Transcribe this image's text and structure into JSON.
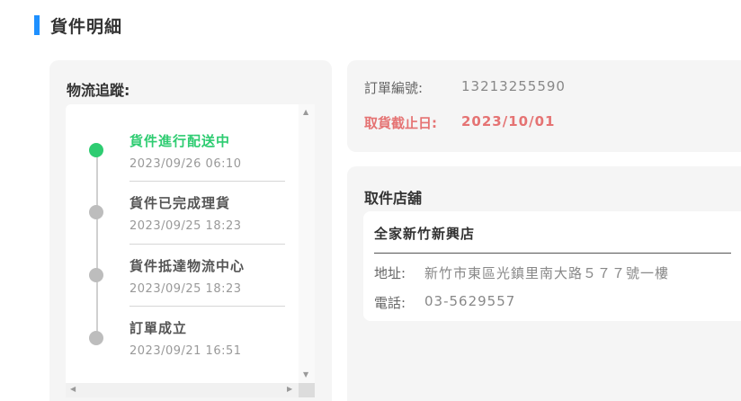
{
  "header": {
    "title": "貨件明細"
  },
  "tracking": {
    "label": "物流追蹤:",
    "steps": [
      {
        "title": "貨件進行配送中",
        "time": "2023/09/26 06:10",
        "active": true
      },
      {
        "title": "貨件已完成理貨",
        "time": "2023/09/25 18:23",
        "active": false
      },
      {
        "title": "貨件抵達物流中心",
        "time": "2023/09/25 18:23",
        "active": false
      },
      {
        "title": "訂單成立",
        "time": "2023/09/21 16:51",
        "active": false
      }
    ]
  },
  "order": {
    "number_label": "訂單編號:",
    "number_value": "13213255590",
    "deadline_label": "取貨截止日:",
    "deadline_value": "2023/10/01"
  },
  "store": {
    "title": "取件店舖",
    "name": "全家新竹新興店",
    "address_label": "地址:",
    "address_value": "新竹市東區光鎮里南大路５７７號一樓",
    "phone_label": "電話:",
    "phone_value": "03-5629557"
  },
  "colors": {
    "accent": "#1e90ff",
    "active_step": "#2ecc71",
    "deadline": "#e57373",
    "inactive_dot": "#bdbdbd"
  },
  "icons": {
    "scroll_up": "▲",
    "scroll_down": "▼",
    "scroll_left": "◀",
    "scroll_right": "▶"
  }
}
